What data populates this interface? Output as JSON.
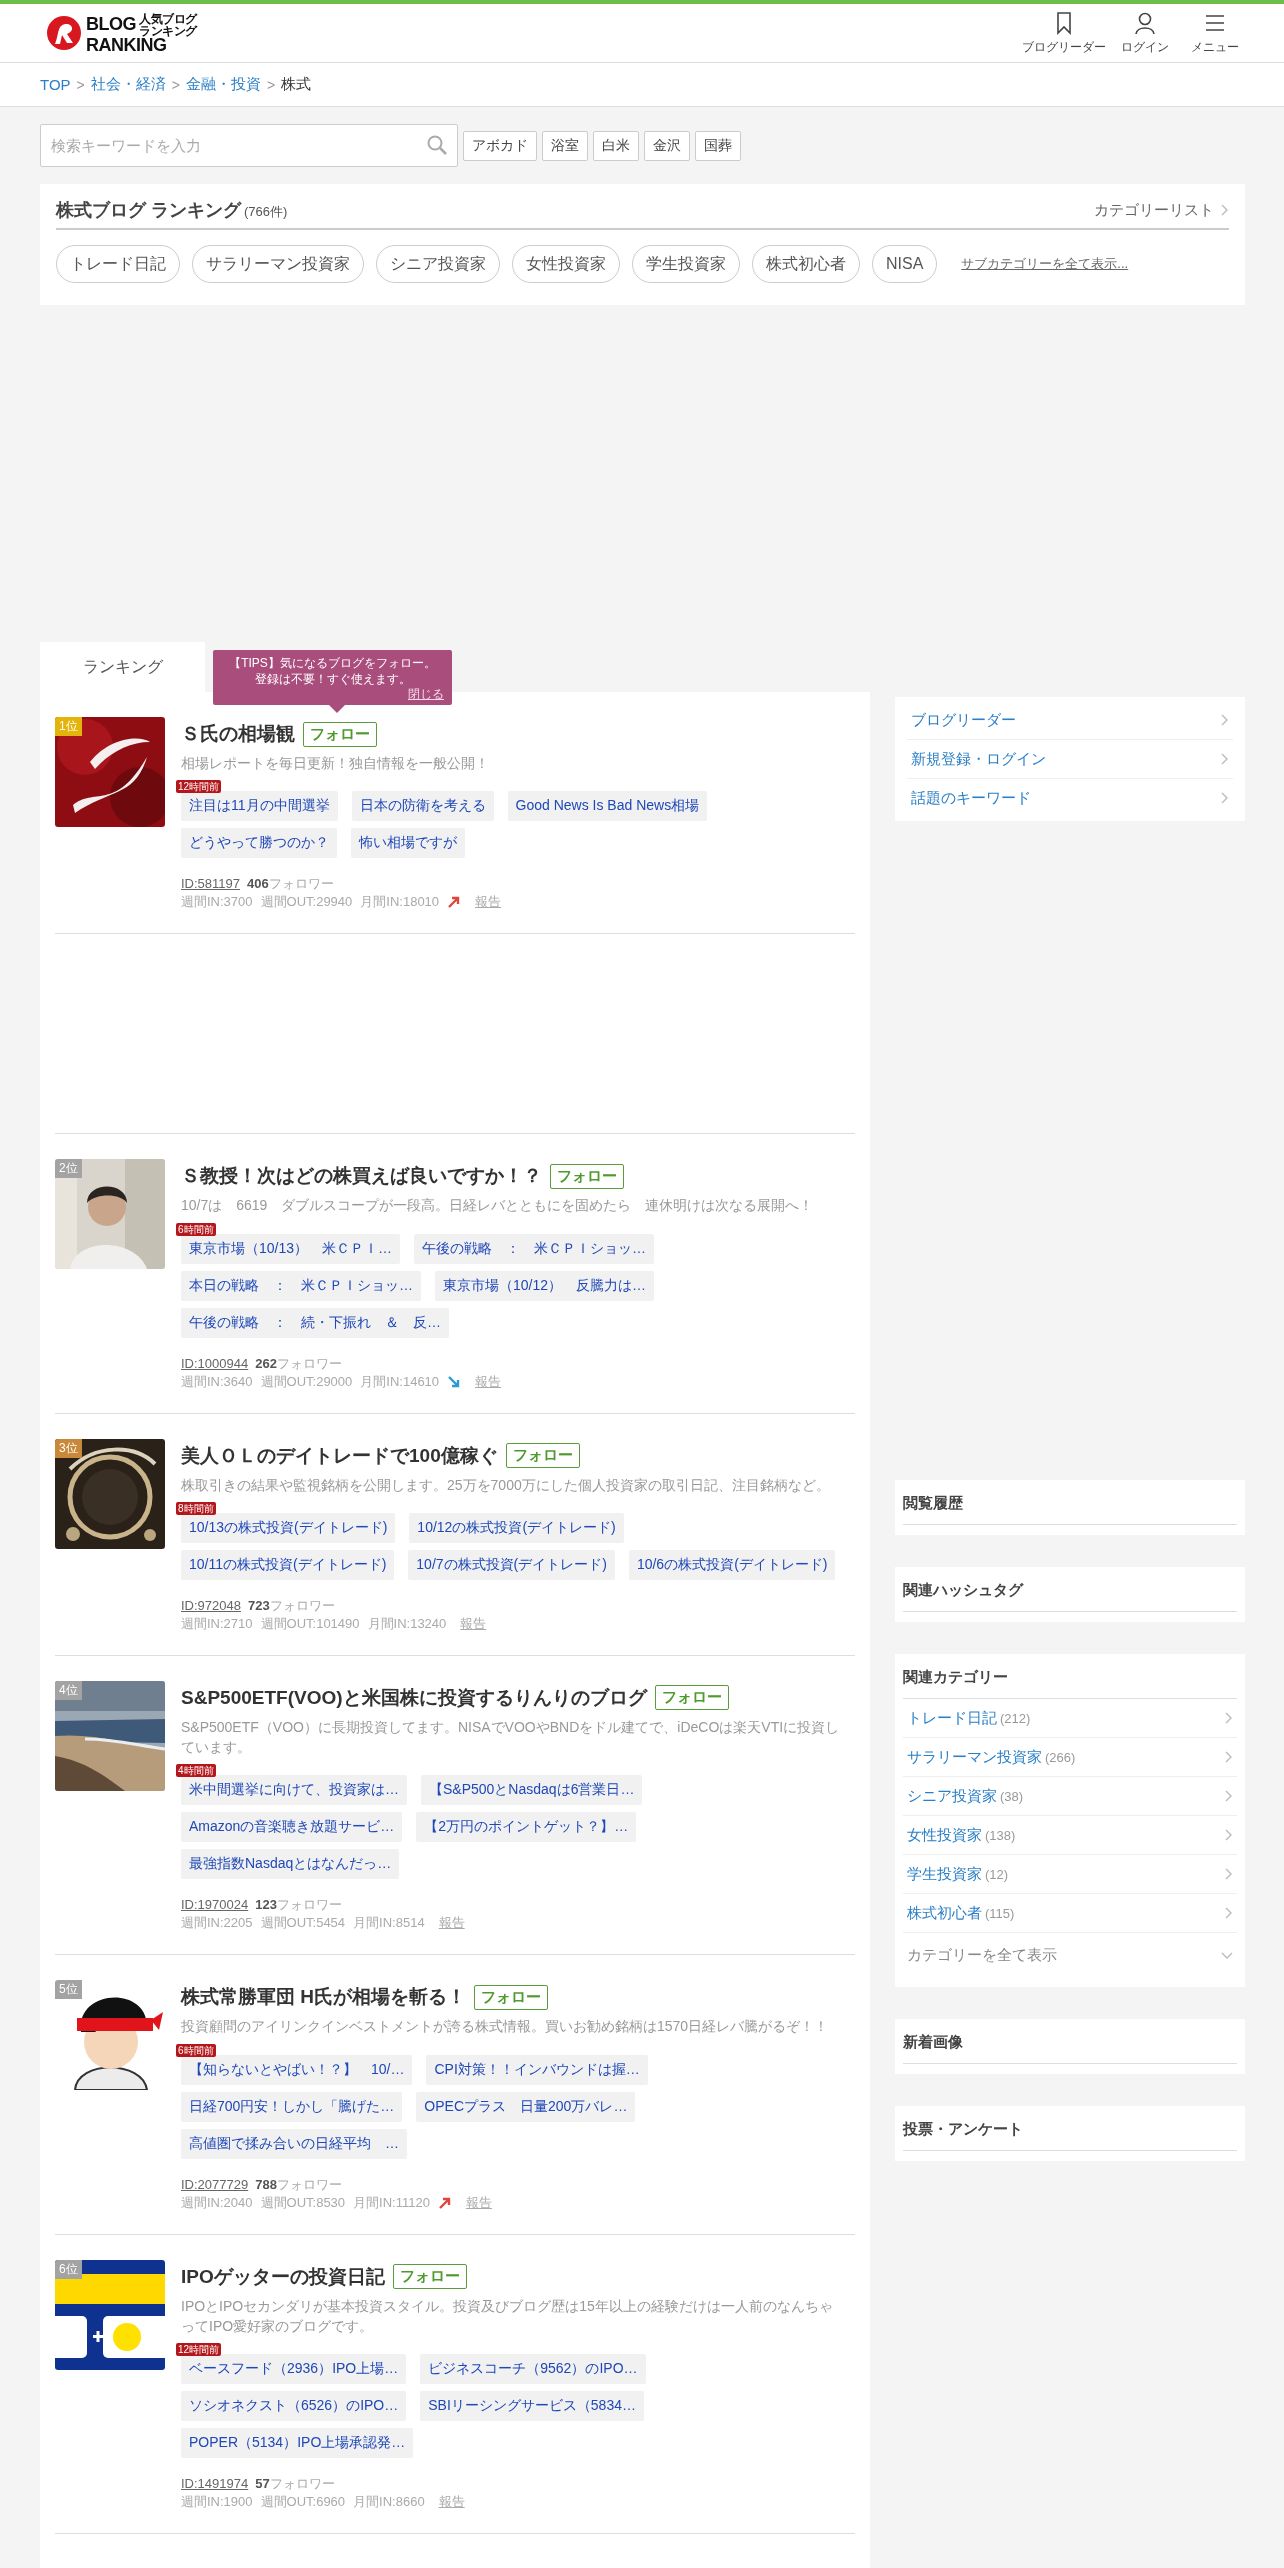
{
  "header": {
    "logo": {
      "line1": "BLOG",
      "line2": "RANKING",
      "sub1": "人気ブログ",
      "sub2": "ランキング"
    },
    "nav": [
      {
        "label": "ブログリーダー",
        "kind": "bookmark"
      },
      {
        "label": "ログイン",
        "kind": "user"
      },
      {
        "label": "メニュー",
        "kind": "menu"
      }
    ]
  },
  "breadcrumb": [
    {
      "label": "TOP",
      "kind": "link"
    },
    {
      "label": ">",
      "kind": "separator"
    },
    {
      "label": "社会・経済",
      "kind": "link"
    },
    {
      "label": ">",
      "kind": "separator"
    },
    {
      "label": "金融・投資",
      "kind": "link"
    },
    {
      "label": ">",
      "kind": "separator"
    },
    {
      "label": "株式",
      "kind": "current"
    }
  ],
  "search": {
    "placeholder": "検索キーワードを入力",
    "keywords": [
      "アボカド",
      "浴室",
      "白米",
      "金沢",
      "国葬"
    ]
  },
  "category": {
    "title": "株式ブログ ランキング",
    "count": "(766件)",
    "list_link": "カテゴリーリスト",
    "subcategories": [
      "トレード日記",
      "サラリーマン投資家",
      "シニア投資家",
      "女性投資家",
      "学生投資家",
      "株式初心者",
      "NISA"
    ],
    "show_all": "サブカテゴリーを全て表示..."
  },
  "tabs": [
    {
      "label": "ランキング",
      "selected": true
    }
  ],
  "tip": {
    "lines": [
      "【TIPS】気になるブログをフォロー。",
      "登録は不要！すぐ使えます。"
    ],
    "close": "閉じる"
  },
  "entries": [
    {
      "rank": "1位",
      "color": "#e5b40c",
      "title": "Ｓ氏の相場観",
      "follow": "フォロー",
      "description": "相場レポートを毎日更新！独自情報を一般公開！",
      "updated": "12時間前",
      "articles": [
        "注目は11月の中間選挙",
        "日本の防衛を考える",
        "Good News Is Bad News相場",
        "どうやって勝つのか？",
        "怖い相場ですが"
      ],
      "id": "ID:581197",
      "followers": "406",
      "followers_label": "フォロワー",
      "weekly_in": "週間IN:3700",
      "weekly_out": "週間OUT:29940",
      "monthly_in": "月間IN:18010",
      "kind": "rising",
      "report": "報告"
    },
    {
      "rank": "2位",
      "color": "#a3a3a3",
      "title": "Ｓ教授！次はどの株買えば良いですか！？",
      "follow": "フォロー",
      "description": "10/7は　6619　ダブルスコープが一段高。日経レバとともにを固めたら　連休明けは次なる展開へ！",
      "updated": "6時間前",
      "articles": [
        "東京市場（10/13）　米ＣＰＩ…",
        "午後の戦略　：　米ＣＰＩショッ…",
        "本日の戦略　：　米ＣＰＩショッ…",
        "東京市場（10/12）　反騰力は…",
        "午後の戦略　：　続・下振れ　＆　反…"
      ],
      "id": "ID:1000944",
      "followers": "262",
      "followers_label": "フォロワー",
      "weekly_in": "週間IN:3640",
      "weekly_out": "週間OUT:29000",
      "monthly_in": "月間IN:14610",
      "kind": "falling",
      "report": "報告"
    },
    {
      "rank": "3位",
      "color": "#c8893a",
      "title": "美人ＯＬのデイトレードで100億稼ぐ",
      "follow": "フォロー",
      "description": "株取引きの結果や監視銘柄を公開します。25万を7000万にした個人投資家の取引日記、注目銘柄など。",
      "updated": "8時間前",
      "articles": [
        "10/13の株式投資(デイトレード)",
        "10/12の株式投資(デイトレード)",
        "10/11の株式投資(デイトレード)",
        "10/7の株式投資(デイトレード)",
        "10/6の株式投資(デイトレード)"
      ],
      "id": "ID:972048",
      "followers": "723",
      "followers_label": "フォロワー",
      "weekly_in": "週間IN:2710",
      "weekly_out": "週間OUT:101490",
      "monthly_in": "月間IN:13240",
      "kind": "steady",
      "report": "報告"
    },
    {
      "rank": "4位",
      "color": "#a3a3a3",
      "title": "S&P500ETF(VOO)と米国株に投資するりんりのブログ",
      "follow": "フォロー",
      "description": "S&P500ETF（VOO）に長期投資してます。NISAでVOOやBNDをドル建てで、iDeCOは楽天VTIに投資しています。",
      "updated": "4時間前",
      "articles": [
        "米中間選挙に向けて、投資家は…",
        "【S&P500とNasdaqは6営業日…",
        "Amazonの音楽聴き放題サービ…",
        "【2万円のポイントゲット？】…",
        "最強指数Nasdaqとはなんだっ…"
      ],
      "id": "ID:1970024",
      "followers": "123",
      "followers_label": "フォロワー",
      "weekly_in": "週間IN:2205",
      "weekly_out": "週間OUT:5454",
      "monthly_in": "月間IN:8514",
      "kind": "steady",
      "report": "報告"
    },
    {
      "rank": "5位",
      "color": "#a3a3a3",
      "title": "株式常勝軍団 H氏が相場を斬る！",
      "follow": "フォロー",
      "description": "投資顧問のアイリンクインベストメントが誇る株式情報。買いお勧め銘柄は1570日経レバ騰がるぞ！！",
      "updated": "6時間前",
      "articles": [
        "【知らないとやばい！？】　10/…",
        "CPI対策！！インバウンドは握…",
        "日経700円安！しかし「騰げた…",
        "OPECプラス　日量200万バレ…",
        "高値圏で揉み合いの日経平均　…"
      ],
      "id": "ID:2077729",
      "followers": "788",
      "followers_label": "フォロワー",
      "weekly_in": "週間IN:2040",
      "weekly_out": "週間OUT:8530",
      "monthly_in": "月間IN:11120",
      "kind": "rising",
      "report": "報告"
    },
    {
      "rank": "6位",
      "color": "#a3a3a3",
      "title": "IPOゲッターの投資日記",
      "follow": "フォロー",
      "description": "IPOとIPOセカンダリが基本投資スタイル。投資及びブログ歴は15年以上の経験だけは一人前のなんちゃってIPO愛好家のブログです。",
      "updated": "12時間前",
      "articles": [
        "ベースフード（2936）IPO上場…",
        "ビジネスコーチ（9562）のIPO…",
        "ソシオネクスト（6526）のIPO…",
        "SBIリーシングサービス（5834…",
        "POPER（5134）IPO上場承認発…"
      ],
      "id": "ID:1491974",
      "followers": "57",
      "followers_label": "フォロワー",
      "weekly_in": "週間IN:1900",
      "weekly_out": "週間OUT:6960",
      "monthly_in": "月間IN:8660",
      "kind": "steady",
      "report": "報告"
    }
  ],
  "sidebar": {
    "links": [
      "ブログリーダー",
      "新規登録・ログイン",
      "話題のキーワード"
    ],
    "sections": [
      {
        "title": "閲覧履歴"
      },
      {
        "title": "関連ハッシュタグ"
      },
      {
        "title": "関連カテゴリー",
        "items": [
          {
            "name": "トレード日記",
            "count": "(212)"
          },
          {
            "name": "サラリーマン投資家",
            "count": "(266)"
          },
          {
            "name": "シニア投資家",
            "count": "(38)"
          },
          {
            "name": "女性投資家",
            "count": "(138)"
          },
          {
            "name": "学生投資家",
            "count": "(12)"
          },
          {
            "name": "株式初心者",
            "count": "(115)"
          }
        ],
        "more": "カテゴリーを全て表示"
      },
      {
        "title": "新着画像"
      },
      {
        "title": "投票・アンケート"
      }
    ]
  }
}
